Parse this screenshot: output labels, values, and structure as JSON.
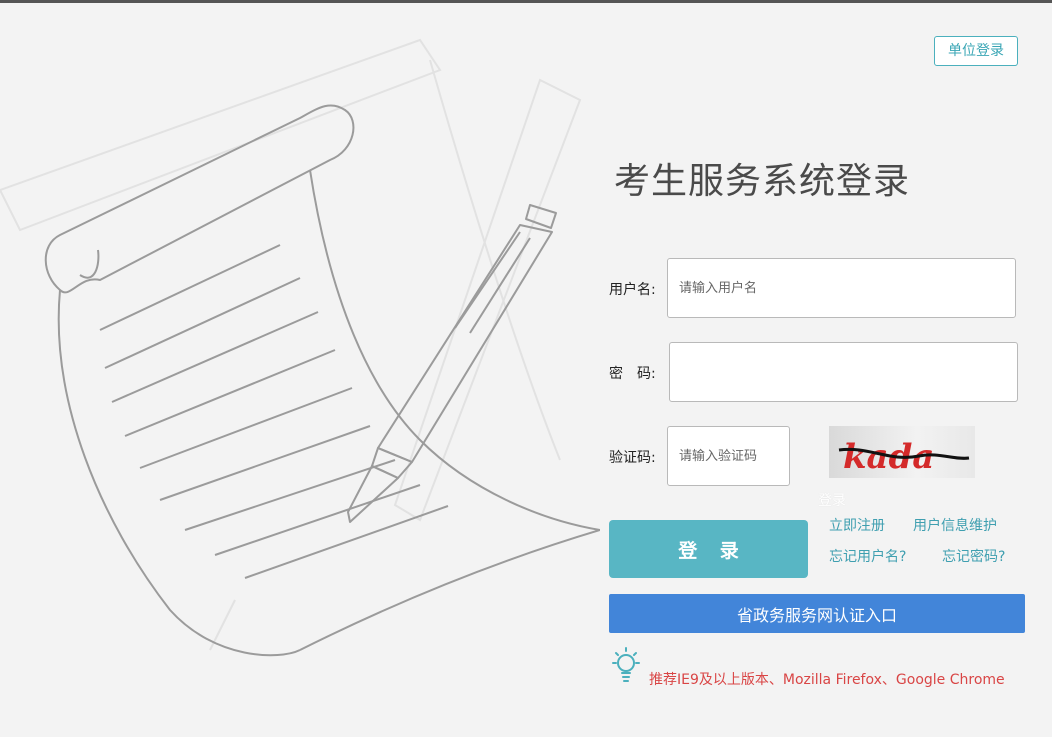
{
  "header": {
    "unit_login": "单位登录"
  },
  "login": {
    "title": "考生服务系统登录",
    "username": {
      "label": "用户名:",
      "placeholder": "请输入用户名",
      "value": ""
    },
    "password": {
      "label": "密　码:",
      "placeholder": "",
      "value": ""
    },
    "captcha": {
      "label": "验证码:",
      "placeholder": "请输入验证码",
      "value": "",
      "image_text": "kada",
      "alt_text": "登录"
    },
    "submit_label": "登 录",
    "links": {
      "register": "立即注册",
      "profile": "用户信息维护",
      "forgot_username": "忘记用户名?",
      "forgot_password": "忘记密码?"
    },
    "gov_portal_label": "省政务服务网认证入口",
    "browser_tip": "推荐IE9及以上版本、Mozilla Firefox、Google Chrome"
  },
  "icons": [
    "letter-pen-illustration",
    "lightbulb-icon"
  ],
  "colors": {
    "accent": "#58b6c4",
    "link": "#3f9fb0",
    "gov_button": "#4285d9",
    "tip": "#d94545"
  }
}
